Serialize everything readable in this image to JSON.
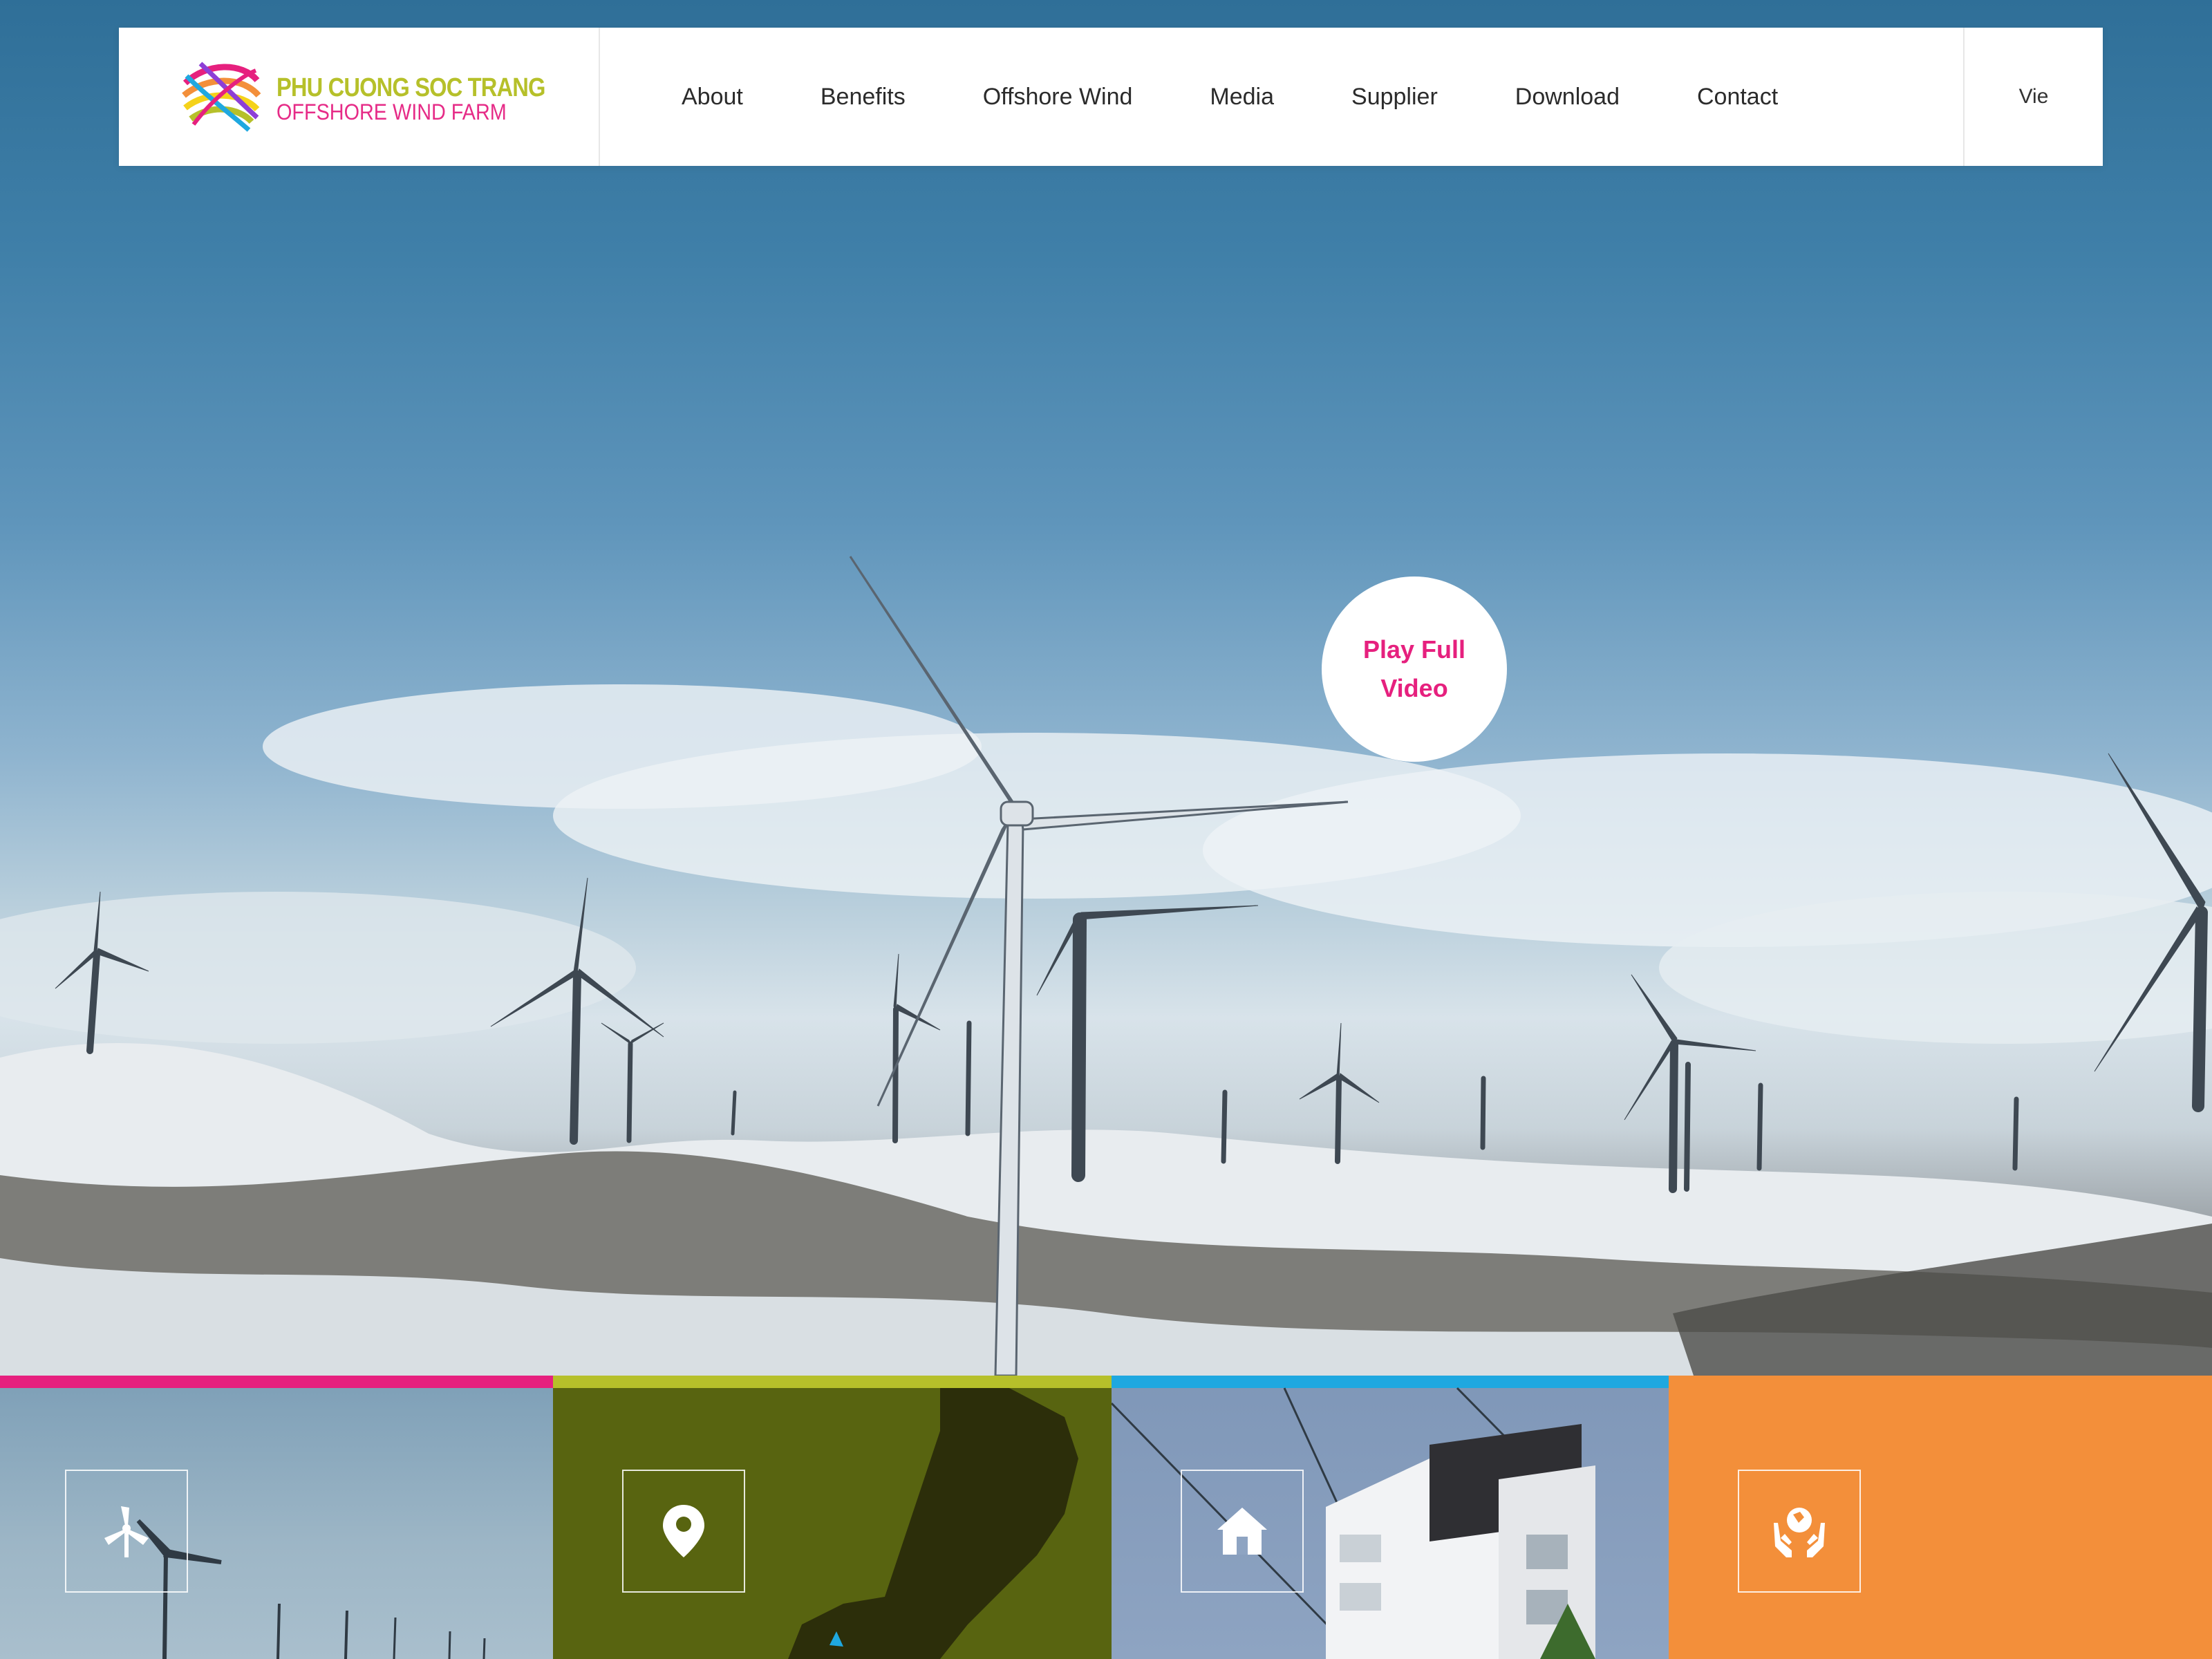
{
  "brand": {
    "line1": "PHU CUONG SOC TRANG",
    "line2": "OFFSHORE WIND FARM",
    "colors": {
      "primary": "#b6c02a",
      "accent": "#e62b87"
    }
  },
  "nav": {
    "items": [
      {
        "label": "About"
      },
      {
        "label": "Benefits"
      },
      {
        "label": "Offshore Wind"
      },
      {
        "label": "Media"
      },
      {
        "label": "Supplier"
      },
      {
        "label": "Download"
      },
      {
        "label": "Contact"
      }
    ],
    "language": "Vie"
  },
  "hero": {
    "play_label": "Play Full Video"
  },
  "tiles": [
    {
      "icon": "wind-turbine-icon",
      "bar_color": "#e6207e"
    },
    {
      "icon": "map-pin-icon",
      "bar_color": "#b6c02a"
    },
    {
      "icon": "house-icon",
      "bar_color": "#1fa8e0"
    },
    {
      "icon": "hands-globe-icon",
      "bar_color": "#f38f3a"
    }
  ]
}
